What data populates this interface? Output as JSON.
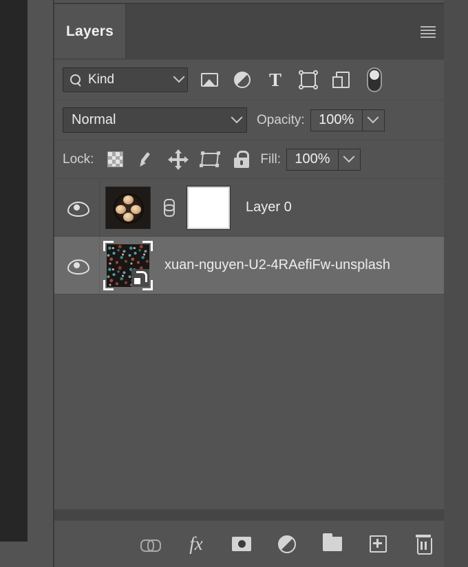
{
  "panel": {
    "tab_label": "Layers",
    "menu_icon": "hamburger-menu-icon"
  },
  "filter_bar": {
    "search_icon": "search-icon",
    "filter_type": "Kind",
    "chevron_icon": "chevron-down-icon",
    "filter_icons": [
      {
        "name": "pixel-layer-filter-icon",
        "label": "Pixel"
      },
      {
        "name": "adjustment-layer-filter-icon",
        "label": "Adjustment"
      },
      {
        "name": "type-layer-filter-icon",
        "label": "T"
      },
      {
        "name": "shape-layer-filter-icon",
        "label": "Shape"
      },
      {
        "name": "smart-object-filter-icon",
        "label": "Smart Object"
      },
      {
        "name": "filter-toggle-switch",
        "label": "Filter On/Off"
      }
    ]
  },
  "blend_bar": {
    "blend_mode": "Normal",
    "opacity_label": "Opacity:",
    "opacity_value": "100%"
  },
  "lock_bar": {
    "lock_label": "Lock:",
    "lock_icons": [
      {
        "name": "lock-transparent-pixels-icon"
      },
      {
        "name": "lock-image-pixels-icon"
      },
      {
        "name": "lock-position-icon"
      },
      {
        "name": "lock-artboard-nesting-icon"
      },
      {
        "name": "lock-all-icon"
      }
    ],
    "fill_label": "Fill:",
    "fill_value": "100%"
  },
  "layers": [
    {
      "name": "Layer 0",
      "visible": true,
      "selected": false,
      "has_mask": true,
      "linked": true,
      "thumbnail_type": "photo-thumbnail"
    },
    {
      "name": "xuan-nguyen-U2-4RAefiFw-unsplash",
      "visible": true,
      "selected": true,
      "has_mask": false,
      "linked": false,
      "thumbnail_type": "smart-object-thumbnail"
    }
  ],
  "bottom_toolbar": [
    {
      "name": "link-layers-button",
      "label": "Link layers"
    },
    {
      "name": "layer-style-fx-button",
      "label": "fx"
    },
    {
      "name": "add-layer-mask-button",
      "label": "Add layer mask"
    },
    {
      "name": "new-adjustment-layer-button",
      "label": "New adjustment layer"
    },
    {
      "name": "new-group-button",
      "label": "New group"
    },
    {
      "name": "new-layer-button",
      "label": "New layer"
    },
    {
      "name": "delete-layer-button",
      "label": "Delete layer"
    }
  ],
  "colors": {
    "panel_bg": "#535353",
    "panel_chrome": "#454545",
    "selected_row": "#6b6b6b",
    "text": "#ededed",
    "dark_strip": "#262626"
  }
}
